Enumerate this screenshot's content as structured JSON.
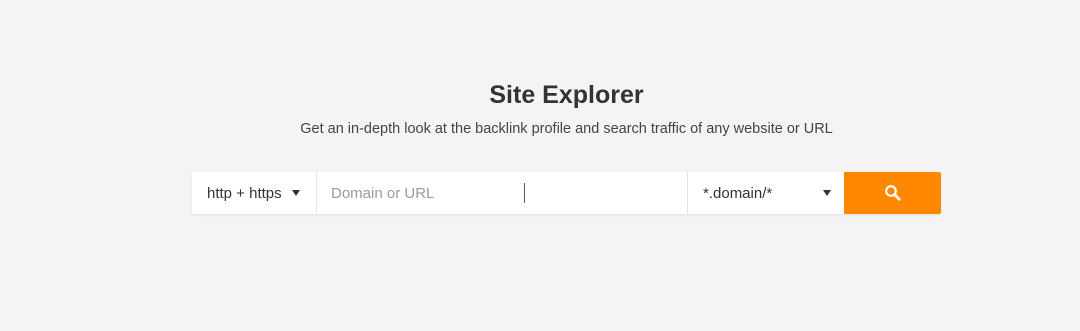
{
  "page": {
    "title": "Site Explorer",
    "subtitle": "Get an in-depth look at the backlink profile and search traffic of any website or URL"
  },
  "search": {
    "protocol_selected": "http + https",
    "protocol_icon": "chevron-down-icon",
    "input_value": "",
    "input_placeholder": "Domain or URL",
    "mode_selected": "*.domain/*",
    "mode_icon": "chevron-down-icon",
    "button_icon": "search-icon"
  },
  "colors": {
    "background": "#f4f4f4",
    "accent": "#ff8800",
    "text": "#333333",
    "placeholder": "#9a9a9a"
  }
}
